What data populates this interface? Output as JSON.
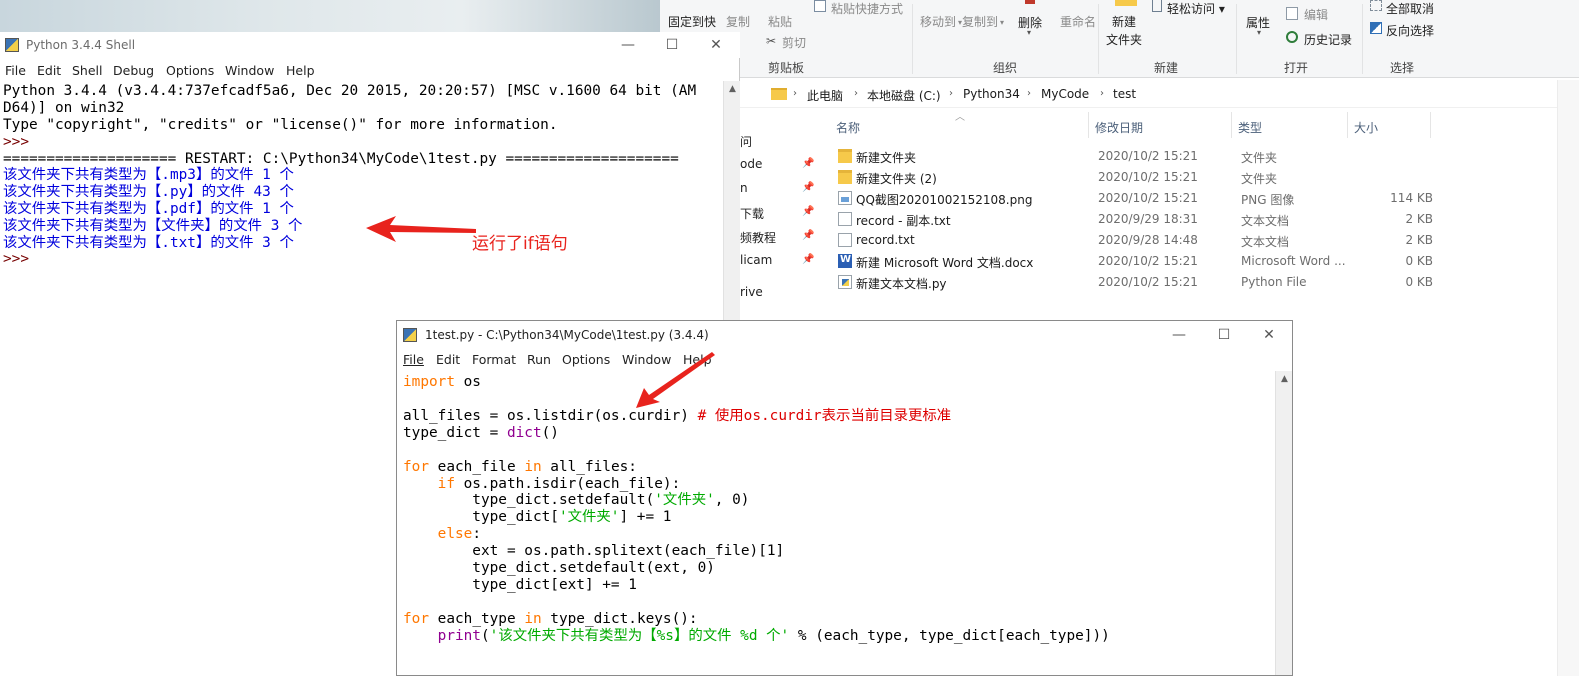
{
  "explorer": {
    "ribbon": {
      "clipboard": {
        "pin_label": "固定到快",
        "copy": "复制",
        "paste": "粘贴",
        "paste_shortcut": "粘贴快捷方式",
        "cut": "剪切",
        "group": "剪贴板"
      },
      "organize": {
        "move_to": "移动到",
        "copy_to": "复制到",
        "delete": "删除",
        "rename": "重命名",
        "group": "组织"
      },
      "new": {
        "new_folder": "新建\n文件夹",
        "new_folder_line1": "新建",
        "new_folder_line2": "文件夹",
        "easy_access": "轻松访问 ▾",
        "group": "新建"
      },
      "open": {
        "properties": "属性",
        "edit": "编辑",
        "history": "历史记录",
        "group": "打开"
      },
      "select": {
        "select_none": "全部取消",
        "invert": "反向选择",
        "group": "选择"
      }
    },
    "address": {
      "crumbs": [
        "此电脑",
        "本地磁盘 (C:)",
        "Python34",
        "MyCode",
        "test"
      ]
    },
    "nav_items": [
      "问",
      "ode",
      "n",
      "下载",
      "频教程",
      "licam",
      "rive"
    ],
    "columns": {
      "name": "名称",
      "date": "修改日期",
      "type": "类型",
      "size": "大小"
    },
    "files": [
      {
        "name": "新建文件夹",
        "date": "2020/10/2 15:21",
        "type": "文件夹",
        "size": "",
        "icon": "folder-icon"
      },
      {
        "name": "新建文件夹 (2)",
        "date": "2020/10/2 15:21",
        "type": "文件夹",
        "size": "",
        "icon": "folder-icon"
      },
      {
        "name": "QQ截图20201002152108.png",
        "date": "2020/10/2 15:21",
        "type": "PNG 图像",
        "size": "114 KB",
        "icon": "png-icon"
      },
      {
        "name": "record - 副本.txt",
        "date": "2020/9/29 18:31",
        "type": "文本文档",
        "size": "2 KB",
        "icon": "text-file-icon"
      },
      {
        "name": "record.txt",
        "date": "2020/9/28 14:48",
        "type": "文本文档",
        "size": "2 KB",
        "icon": "text-file-icon"
      },
      {
        "name": "新建 Microsoft Word 文档.docx",
        "date": "2020/10/2 15:21",
        "type": "Microsoft Word ...",
        "size": "0 KB",
        "icon": "word-file-icon"
      },
      {
        "name": "新建文本文档.py",
        "date": "2020/10/2 15:21",
        "type": "Python File",
        "size": "0 KB",
        "icon": "python-file-icon"
      }
    ]
  },
  "shell": {
    "title": "Python 3.4.4 Shell",
    "menu": [
      "File",
      "Edit",
      "Shell",
      "Debug",
      "Options",
      "Window",
      "Help"
    ],
    "lines": [
      {
        "text": "Python 3.4.4 (v3.4.4:737efcadf5a6, Dec 20 2015, 20:20:57) [MSC v.1600 64 bit (AM",
        "color": "#000000"
      },
      {
        "text": "D64)] on win32",
        "color": "#000000"
      },
      {
        "text": "Type \"copyright\", \"credits\" or \"license()\" for more information.",
        "color": "#000000"
      },
      {
        "text": ">>> ",
        "color": "#770000"
      },
      {
        "text": "==================== RESTART: C:\\Python34\\MyCode\\1test.py ====================",
        "color": "#000000"
      },
      {
        "text": "该文件夹下共有类型为【.mp3】的文件 1 个",
        "color": "#0000dd"
      },
      {
        "text": "该文件夹下共有类型为【.py】的文件 43 个",
        "color": "#0000dd"
      },
      {
        "text": "该文件夹下共有类型为【.pdf】的文件 1 个",
        "color": "#0000dd"
      },
      {
        "text": "该文件夹下共有类型为【文件夹】的文件 3 个",
        "color": "#0000dd"
      },
      {
        "text": "该文件夹下共有类型为【.txt】的文件 3 个",
        "color": "#0000dd"
      },
      {
        "text": ">>> ",
        "color": "#770000"
      }
    ]
  },
  "editor": {
    "title": "1test.py - C:\\Python34\\MyCode\\1test.py (3.4.4)",
    "menu": [
      "File",
      "Edit",
      "Format",
      "Run",
      "Options",
      "Window",
      "Help"
    ]
  },
  "annotations": {
    "if_note": "运行了if语句"
  },
  "colors": {
    "annotation": "#e8231d",
    "keyword": "#ff7700",
    "builtin": "#900090",
    "string": "#00aa00",
    "comment": "#dd0000",
    "shell_output": "#0000dd"
  }
}
